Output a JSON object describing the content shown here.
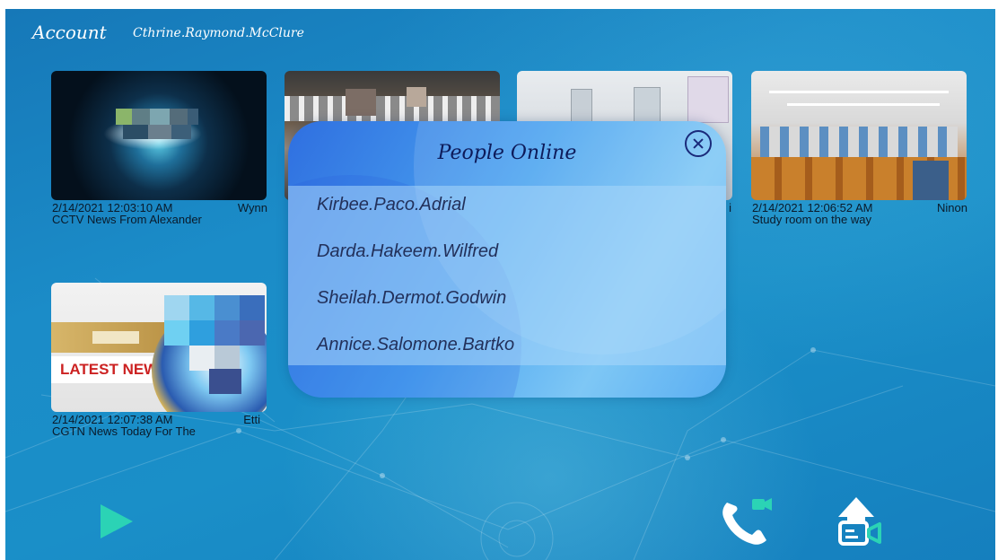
{
  "header": {
    "account_label": "Account",
    "account_name": "Cthrine.Raymond.McClure"
  },
  "tiles": [
    {
      "timestamp": "2/14/2021 12:03:10 AM",
      "user": "Wynn",
      "title": "CCTV News From Alexander"
    },
    {
      "timestamp": "2/14/2021 12:07:38 AM",
      "user": "Etti",
      "title": "CGTN News Today For The"
    },
    {
      "timestamp": "2/14/2021 12:06:52 AM",
      "user": "Ninon",
      "title": "Study room on the way"
    }
  ],
  "tile_fragments": {
    "classroom_user_tail": "i",
    "news_banner": "LATEST NEWS"
  },
  "popup": {
    "title": "People Online",
    "people": [
      "Kirbee.Paco.Adrial",
      "Darda.Hakeem.Wilfred",
      "Sheilah.Dermot.Godwin",
      "Annice.Salomone.Bartko"
    ]
  },
  "icons": {
    "play": "play-icon",
    "call": "video-call-icon",
    "upload": "upload-video-icon",
    "close": "close-icon"
  },
  "colors": {
    "accent": "#2bd3b5",
    "background": "#1a8cc8",
    "popup_title": "#0d1b5a"
  }
}
